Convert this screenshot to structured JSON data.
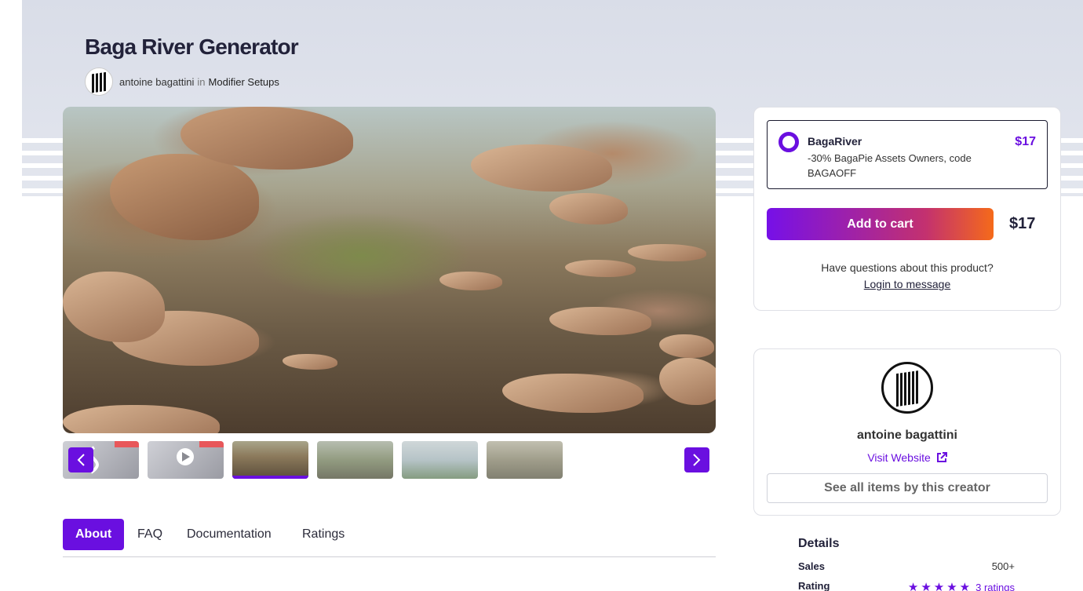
{
  "product": {
    "title": "Baga River Generator"
  },
  "author": {
    "name": "antoine bagattini",
    "in_label": "in",
    "category": "Modifier Setups"
  },
  "gallery": {
    "prev_icon": "chevron-left-icon",
    "next_icon": "chevron-right-icon",
    "thumbnails": [
      {
        "kind": "logo"
      },
      {
        "kind": "video"
      },
      {
        "kind": "image",
        "active": true
      },
      {
        "kind": "image"
      },
      {
        "kind": "image"
      },
      {
        "kind": "image"
      }
    ]
  },
  "tabs": [
    {
      "label": "About",
      "active": true
    },
    {
      "label": "FAQ"
    },
    {
      "label": "Documentation"
    },
    {
      "label": "Ratings"
    }
  ],
  "purchase": {
    "option_name": "BagaRiver",
    "option_description": "-30% BagaPie Assets Owners, code BAGAOFF",
    "option_price": "$17",
    "add_to_cart": "Add to cart",
    "total_price": "$17",
    "question": "Have questions about this product?",
    "login_link": "Login to message"
  },
  "creator": {
    "name": "antoine bagattini",
    "visit_website": "Visit Website",
    "see_all": "See all items by this creator"
  },
  "details": {
    "heading": "Details",
    "sales_label": "Sales",
    "sales_value": "500+",
    "rating_label": "Rating",
    "rating_stars": 5,
    "rating_count": "3 ratings"
  },
  "colors": {
    "accent": "#6a0fe0",
    "gradient_end": "#f56a1a"
  }
}
